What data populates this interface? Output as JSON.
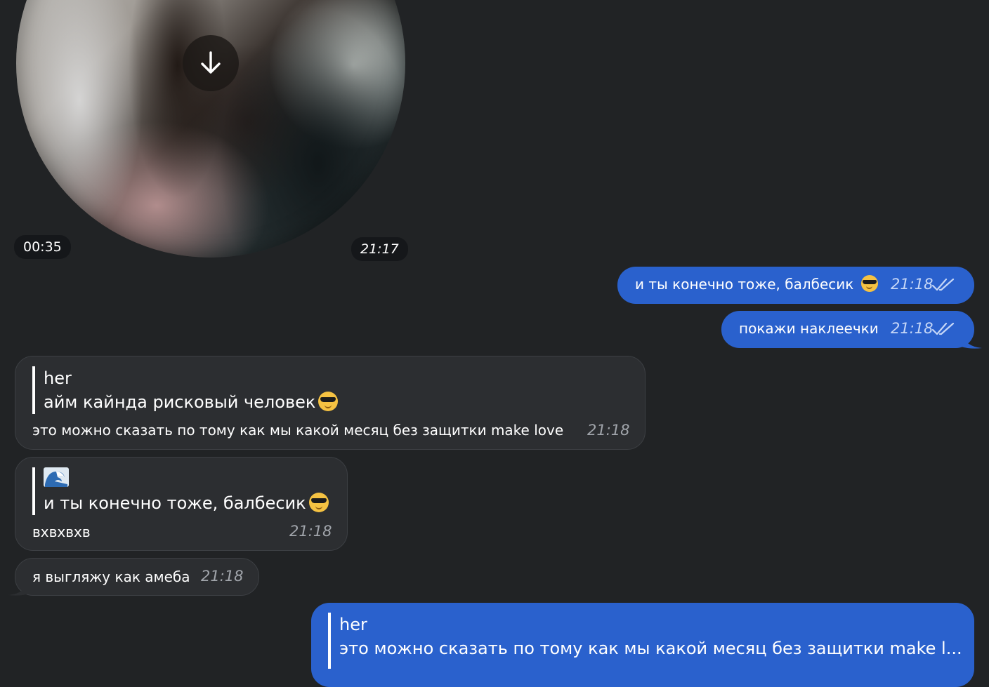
{
  "video": {
    "duration": "00:35",
    "time": "21:17",
    "download_icon": "arrow-down-icon"
  },
  "messages": [
    {
      "id": "m1",
      "direction": "outgoing",
      "text": "и ты конечно тоже, балбесик",
      "emoji": "smiling-face-with-sunglasses",
      "time": "21:18",
      "status_icon": "double-check-icon"
    },
    {
      "id": "m2",
      "direction": "outgoing",
      "text": "покажи наклеечки",
      "time": "21:18",
      "status_icon": "double-check-icon"
    },
    {
      "id": "m3",
      "direction": "incoming",
      "reply_name": "her",
      "reply_text": "айм кайнда рисковый человек",
      "reply_emoji": "smiling-face-with-sunglasses",
      "text": "это можно сказать по тому как мы какой месяц без защитки make love",
      "time": "21:18"
    },
    {
      "id": "m4",
      "direction": "incoming",
      "reply_emoji_top": "water-wave",
      "reply_text": "и ты конечно тоже, балбесик",
      "reply_emoji": "smiling-face-with-sunglasses",
      "text": "вхвхвхв",
      "time": "21:18"
    },
    {
      "id": "m5",
      "direction": "incoming",
      "text": "я выгляжу как амеба",
      "time": "21:18"
    },
    {
      "id": "m6",
      "direction": "outgoing",
      "reply_name": "her",
      "reply_text": "это можно сказать по тому как мы какой месяц без защитки make l..."
    }
  ],
  "colors": {
    "background": "#212325",
    "outgoing_bubble": "#2a61cd",
    "incoming_bubble": "#2c2e31",
    "pill": "#15171a"
  }
}
